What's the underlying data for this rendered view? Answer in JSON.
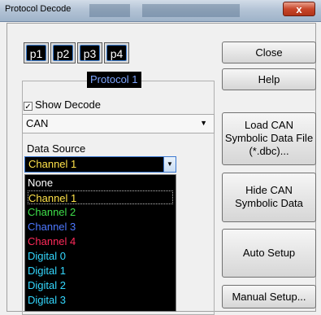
{
  "window": {
    "title": "Protocol Decode",
    "close_glyph": "x"
  },
  "protocol_buttons": [
    "p1",
    "p2",
    "p3",
    "p4"
  ],
  "group": {
    "title": "Protocol 1"
  },
  "show_decode": {
    "label": "Show Decode",
    "checked": true,
    "check_glyph": "✓"
  },
  "protocol_combo": {
    "value": "CAN",
    "arrow": "▼"
  },
  "data_source": {
    "label": "Data Source",
    "selected": "Channel 1",
    "arrow": "▼",
    "options": [
      {
        "label": "None",
        "color": "#ffffff"
      },
      {
        "label": "Channel 1",
        "color": "#ffe24a"
      },
      {
        "label": "Channel 2",
        "color": "#3fe04a"
      },
      {
        "label": "Channel 3",
        "color": "#4d78ff"
      },
      {
        "label": "Channel 4",
        "color": "#ff2a5a"
      },
      {
        "label": "Digital 0",
        "color": "#34d8ff"
      },
      {
        "label": "Digital 1",
        "color": "#34d8ff"
      },
      {
        "label": "Digital 2",
        "color": "#34d8ff"
      },
      {
        "label": "Digital 3",
        "color": "#34d8ff"
      }
    ]
  },
  "right_buttons": {
    "close": "Close",
    "help": "Help",
    "load_can": "Load CAN Symbolic Data File (*.dbc)...",
    "hide_can": "Hide CAN Symbolic Data",
    "auto_setup": "Auto Setup",
    "manual_setup": "Manual Setup..."
  }
}
